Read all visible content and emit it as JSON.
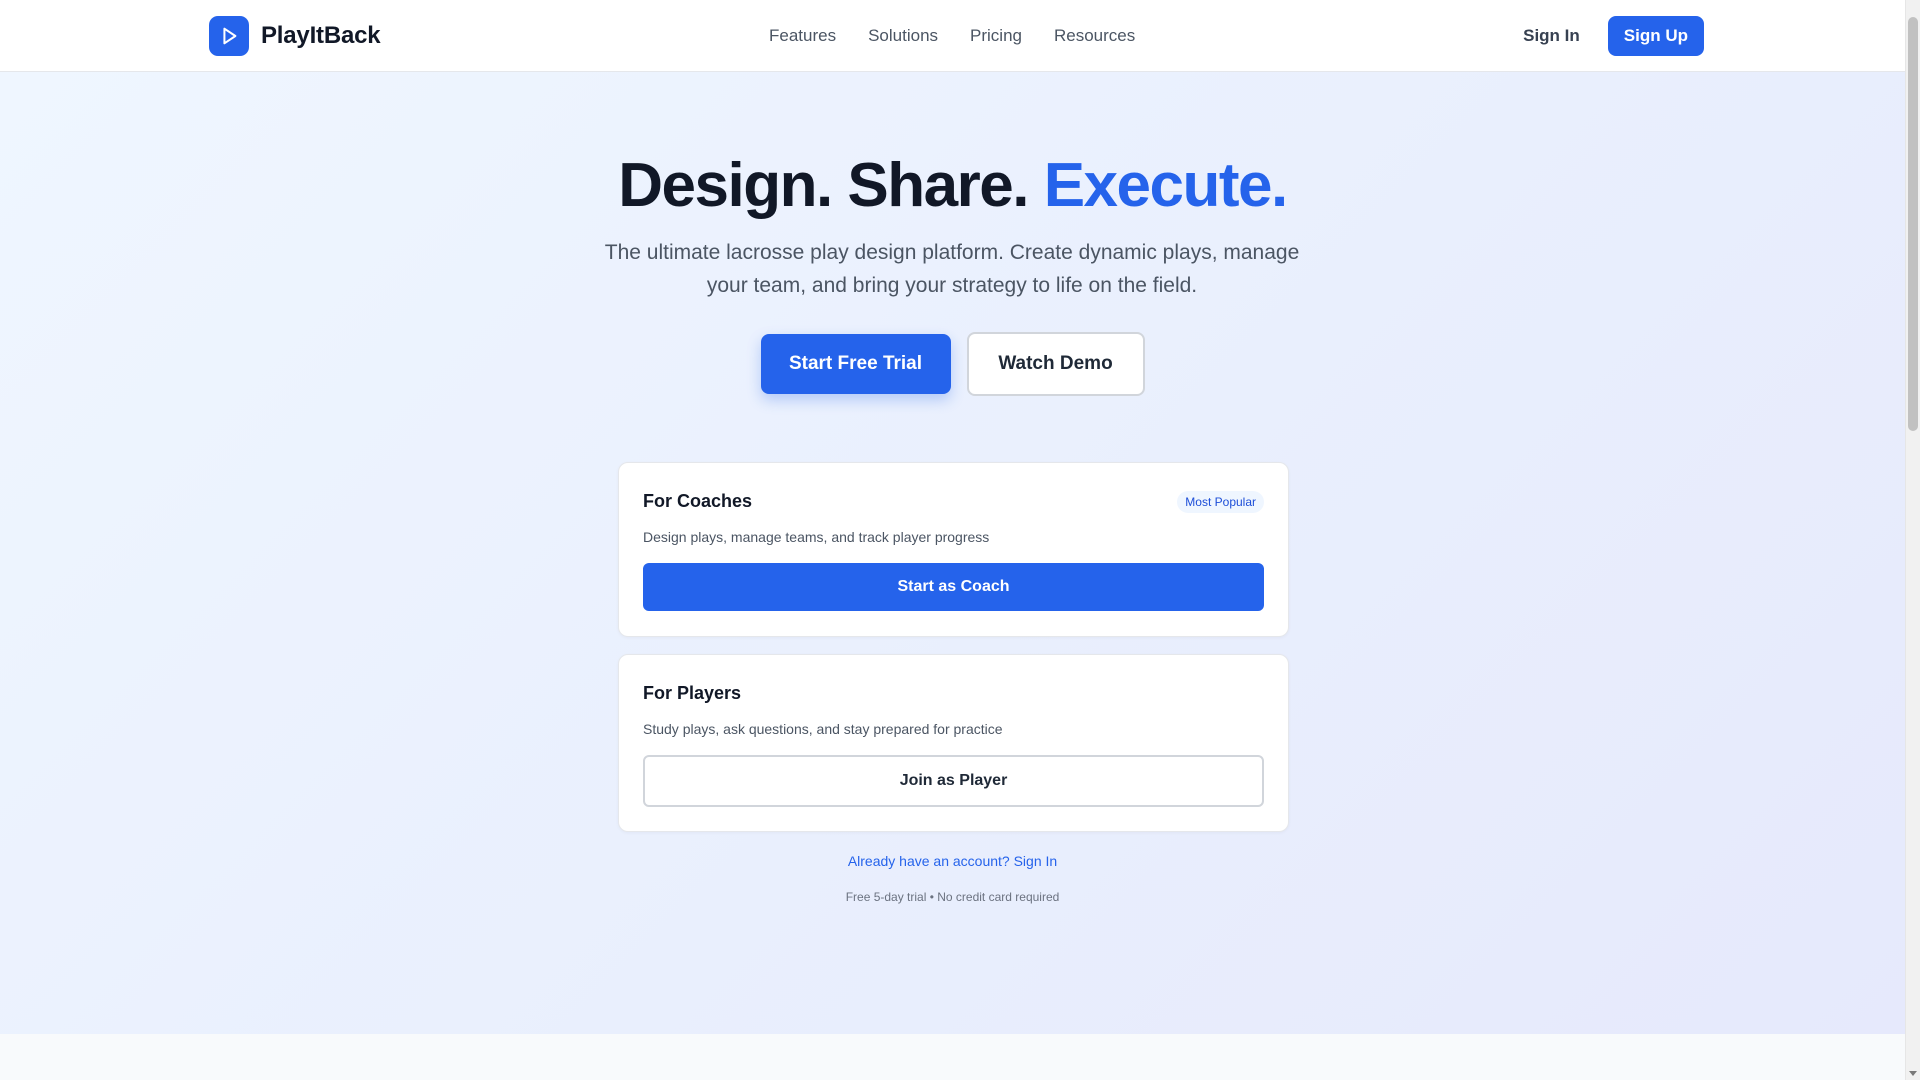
{
  "brand": {
    "name": "PlayItBack",
    "logo_icon": "play-icon",
    "color": "#2563eb"
  },
  "nav": {
    "items": [
      "Features",
      "Solutions",
      "Pricing",
      "Resources"
    ]
  },
  "auth": {
    "sign_in": "Sign In",
    "sign_up": "Sign Up"
  },
  "hero": {
    "title_main": "Design. Share.",
    "title_accent": "Execute.",
    "subtitle": "The ultimate lacrosse play design platform. Create dynamic plays, manage your team, and bring your strategy to life on the field.",
    "cta_primary": "Start Free Trial",
    "cta_secondary": "Watch Demo"
  },
  "cards": {
    "coach": {
      "title": "For Coaches",
      "badge": "Most Popular",
      "description": "Design plays, manage teams, and track player progress",
      "button": "Start as Coach"
    },
    "player": {
      "title": "For Players",
      "description": "Study plays, ask questions, and stay prepared for practice",
      "button": "Join as Player"
    }
  },
  "account_link": "Already have an account? Sign In",
  "fine_print": "Free 5-day trial • No credit card required",
  "colors": {
    "accent": "#2563eb",
    "text_dark": "#111827",
    "text_muted": "#4b5563"
  }
}
